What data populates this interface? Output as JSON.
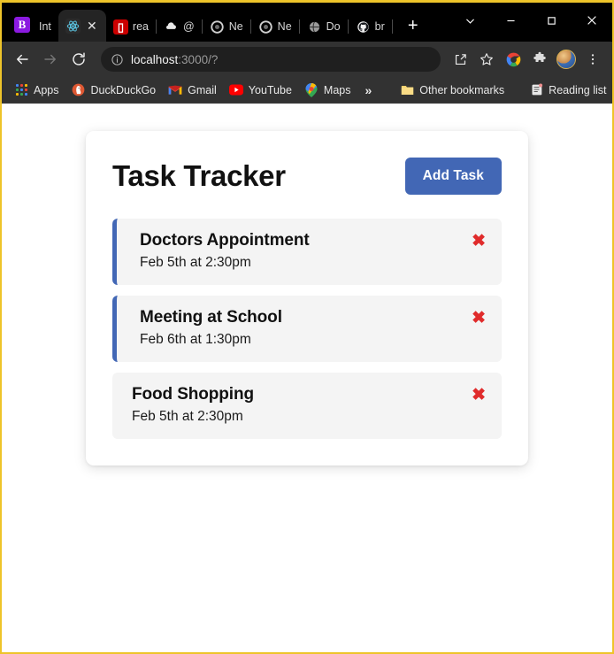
{
  "browser": {
    "tabs": [
      {
        "title": "Int",
        "favicon": "bootstrap-icon",
        "active": false,
        "pinned": true
      },
      {
        "title": "",
        "favicon": "react-icon",
        "active": true,
        "pinned": false
      },
      {
        "title": "rea",
        "favicon": "npm-icon",
        "active": false,
        "pinned": false
      },
      {
        "title": "@",
        "favicon": "dark-cloud-icon",
        "active": false,
        "pinned": false
      },
      {
        "title": "Ne",
        "favicon": "chrome-icon",
        "active": false,
        "pinned": false
      },
      {
        "title": "Ne",
        "favicon": "chrome-icon",
        "active": false,
        "pinned": false
      },
      {
        "title": "Do",
        "favicon": "globe-icon",
        "active": false,
        "pinned": false
      },
      {
        "title": "br",
        "favicon": "github-icon",
        "active": false,
        "pinned": false
      }
    ],
    "new_tab_label": "+",
    "window_controls": {
      "tab_search": "tab-search-chevron",
      "minimize": "minimize",
      "maximize": "maximize",
      "close": "close"
    },
    "toolbar": {
      "back": "back-arrow",
      "forward": "forward-arrow",
      "reload": "reload",
      "site_info": "info-icon",
      "url_host": "localhost",
      "url_rest": ":3000/?",
      "share": "share-icon",
      "bookmark": "star-icon",
      "google_apps": "google-circle-icon",
      "extensions": "puzzle-icon",
      "profile": "avatar",
      "menu": "three-dot-menu"
    },
    "bookmarks": [
      {
        "label": "Apps",
        "icon": "apps-grid-icon"
      },
      {
        "label": "DuckDuckGo",
        "icon": "duckduckgo-icon"
      },
      {
        "label": "Gmail",
        "icon": "gmail-icon"
      },
      {
        "label": "YouTube",
        "icon": "youtube-icon"
      },
      {
        "label": "Maps",
        "icon": "maps-icon"
      }
    ],
    "bookmarks_overflow": "»",
    "other_bookmarks": {
      "label": "Other bookmarks",
      "icon": "folder-icon"
    },
    "reading_list": {
      "label": "Reading list",
      "icon": "reading-list-icon"
    }
  },
  "app": {
    "title": "Task Tracker",
    "add_button": "Add Task",
    "delete_icon": "✖",
    "accent_color": "#4267b5",
    "delete_color": "#e02b2b",
    "tasks": [
      {
        "title": "Doctors Appointment",
        "day": "Feb 5th at 2:30pm",
        "reminder": true
      },
      {
        "title": "Meeting at School",
        "day": "Feb 6th at 1:30pm",
        "reminder": true
      },
      {
        "title": "Food Shopping",
        "day": "Feb 5th at 2:30pm",
        "reminder": false
      }
    ]
  }
}
